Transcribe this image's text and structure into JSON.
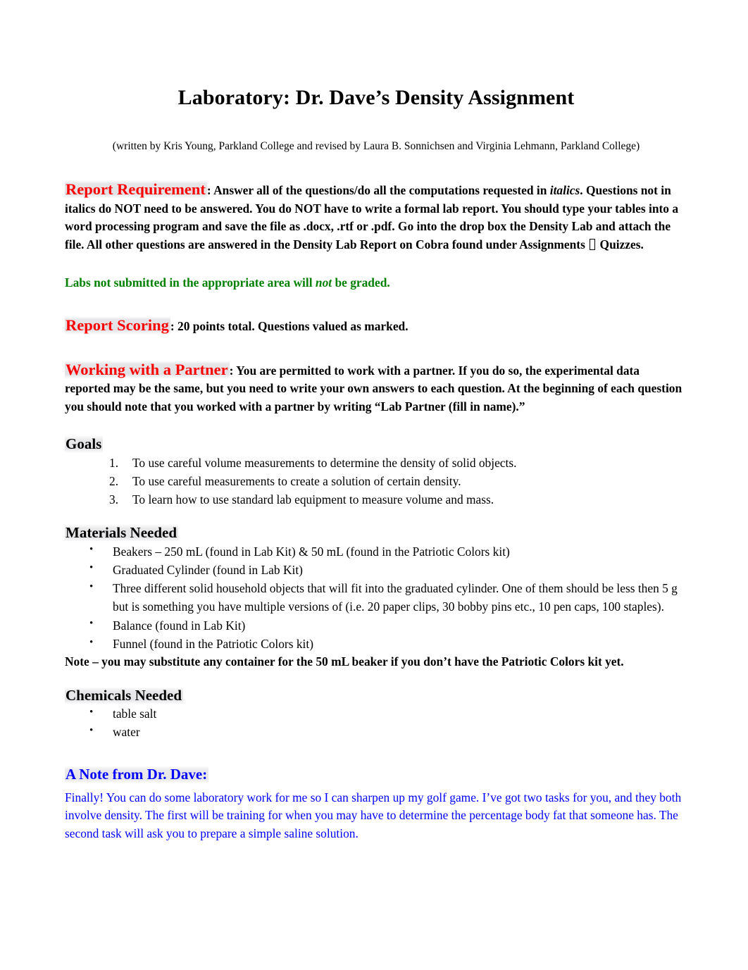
{
  "document": {
    "title": "Laboratory: Dr. Dave’s Density Assignment",
    "byline": "(written by Kris Young, Parkland College and revised by Laura B. Sonnichsen and Virginia Lehmann, Parkland College)"
  },
  "colors": {
    "heading_red": "#ff0000",
    "note_green": "#008000",
    "dave_blue": "#0000ff",
    "body_black": "#000000",
    "highlight": "#e2e2e5",
    "page_background": "#ffffff"
  },
  "report_requirement": {
    "label": "Report Requirement",
    "text_part1": ": Answer all of the questions/do all the computations requested in ",
    "italic_word": "italics",
    "text_part2": ".  Questions not in italics do NOT need to be answered.  You do NOT have to write a formal lab report.  You should type your tables into a word processing program and save the file as .docx, .rtf or .pdf.  Go into the drop box the Density Lab and attach the file. All other questions are answered in the Density Lab Report on Cobra found under Assignments ",
    "missing_glyph": "□",
    "text_part3": " Quizzes."
  },
  "grading_note": {
    "text_part1": "Labs not submitted in the appropriate area will ",
    "italic_word": "not",
    "text_part2": " be graded."
  },
  "report_scoring": {
    "label": "Report Scoring",
    "text": ": 20 points total.  Questions valued as marked."
  },
  "working_with_partner": {
    "label": "Working with a Partner",
    "text": ":  You are permitted to work with a partner.  If you do so, the experimental data reported may be the same, but you need to write your own answers to each question.  At the beginning of each question you should note that you worked with a partner by writing “Lab Partner (fill in name).”"
  },
  "goals": {
    "heading": "Goals",
    "items": [
      {
        "num": "1.",
        "text": "To use careful volume measurements to determine the density of solid objects."
      },
      {
        "num": "2.",
        "text": "To use careful measurements to create a solution of certain density."
      },
      {
        "num": "3.",
        "text": "To learn how to use standard lab equipment to measure volume and mass."
      }
    ]
  },
  "materials_needed": {
    "heading": "Materials Needed",
    "bullet": "•",
    "items": [
      "Beakers – 250 mL (found in Lab Kit) & 50 mL (found in the Patriotic Colors kit)",
      "Graduated Cylinder (found in Lab Kit)",
      "Three different solid household objects that will fit into the graduated cylinder.  One of them should be less then 5 g but is something you have multiple versions of (i.e. 20 paper clips, 30 bobby pins etc., 10 pen caps, 100 staples).",
      "Balance (found in Lab Kit)",
      "Funnel (found in the Patriotic Colors kit)"
    ],
    "note": "Note – you may substitute any container for the 50 mL beaker if you don’t have the Patriotic Colors kit yet."
  },
  "chemicals_needed": {
    "heading": "Chemicals Needed",
    "bullet": "•",
    "items": [
      "table salt",
      "water"
    ]
  },
  "dave_note": {
    "heading": "A Note from Dr. Dave:",
    "body": "Finally!  You can do some laboratory work for me so I can sharpen up my golf game.  I’ve got two tasks for you, and they both involve density.  The first will be training for when you may have to determine the percentage body fat that someone has.  The second task will ask you to prepare a simple saline solution."
  }
}
